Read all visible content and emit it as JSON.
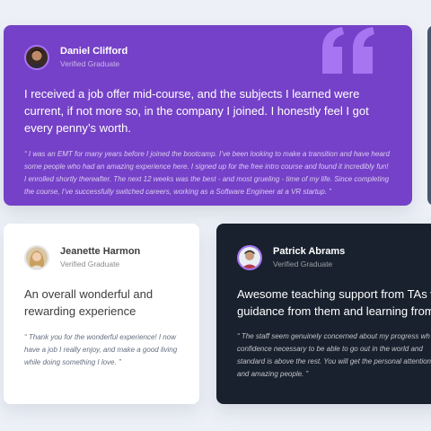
{
  "colors": {
    "page_background": "#edf0f7",
    "moderate_violet": "#7541c8",
    "very_dark_blackish_blue": "#19212e",
    "white": "#ffffff",
    "grayish_blue": "#48556a"
  },
  "testimonials": [
    {
      "name": "Daniel Clifford",
      "role": "Verified Graduate",
      "avatar_icon": "avatar-daniel",
      "headline": "I received a job offer mid-course, and the subjects I learned were current, if not more so, in the company I joined. I honestly feel I got every penny’s worth.",
      "quote": "“ I was an EMT for many years before I joined the bootcamp. I’ve been looking to make a transition and have heard some people who had an amazing experience here. I signed up for the free intro course and found it incredibly fun! I enrolled shortly thereafter. The next 12 weeks was the best - and most grueling - time of my life. Since completing the course, I’ve successfully switched careers, working as a Software Engineer at a VR startup. ”"
    },
    {
      "name": "Jeanette Harmon",
      "role": "Verified Graduate",
      "avatar_icon": "avatar-jeanette",
      "headline": "An overall wonderful and rewarding experience",
      "quote": "“ Thank you for the wonderful experience! I now have a job I really enjoy, and make a good living while doing something I love. ”"
    },
    {
      "name": "Patrick Abrams",
      "role": "Verified Graduate",
      "avatar_icon": "avatar-patrick",
      "headline_lines": [
        "Awesome teaching support from TAs who d",
        "guidance from them and learning from thei"
      ],
      "quote_lines": [
        "“ The staff seem genuinely concerned about my progress wh",
        "confidence necessary to be able to go out in the world and",
        "standard is above the rest. You will get the personal attention",
        "and amazing people. ”"
      ]
    }
  ]
}
